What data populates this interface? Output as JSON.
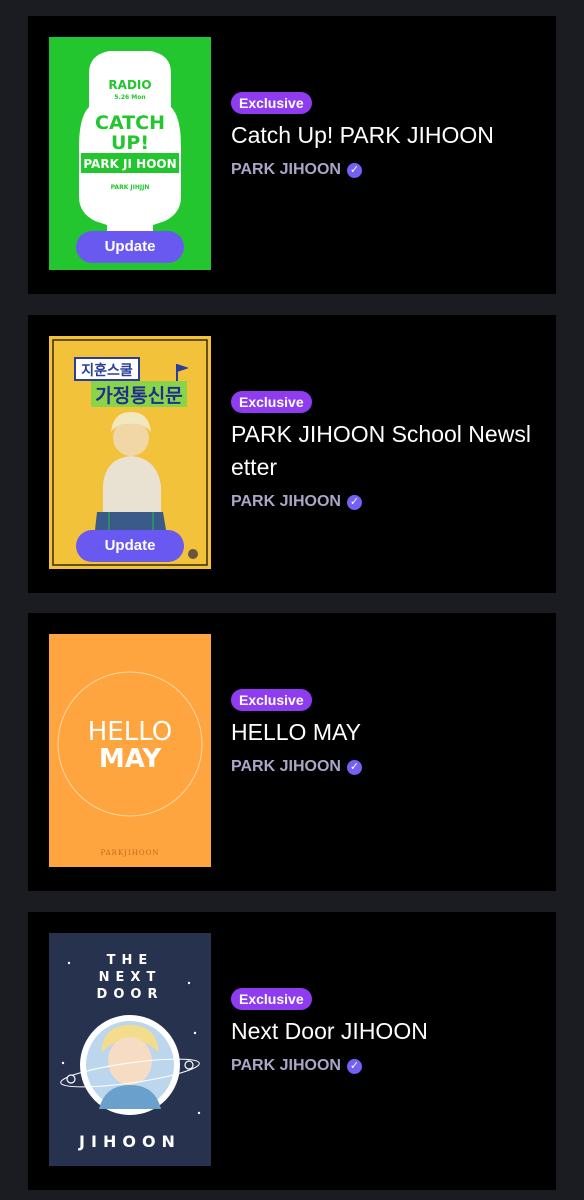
{
  "items": [
    {
      "badge": "Exclusive",
      "title": "Catch Up! PARK JIHOON",
      "artist": "PARK JIHOON",
      "update_label": "Update",
      "cover": {
        "line1": "RADIO",
        "line2": "5.26 Mon",
        "line3": "CATCH",
        "line4": "UP!",
        "line5": "PARK JI HOON",
        "line6": "PARK JIHJJN",
        "color": "#23c62f"
      }
    },
    {
      "badge": "Exclusive",
      "title": "PARK JIHOON School Newsletter",
      "artist": "PARK JIHOON",
      "update_label": "Update",
      "cover": {
        "line1": "지훈스쿨",
        "line2": "가정통신문",
        "color": "#f3c23b"
      }
    },
    {
      "badge": "Exclusive",
      "title": "HELLO MAY",
      "artist": "PARK JIHOON",
      "cover": {
        "line1": "HELLO",
        "line2": "MAY",
        "line3": "PARKJIHOON",
        "color": "#ffa540"
      }
    },
    {
      "badge": "Exclusive",
      "title": "Next Door JIHOON",
      "artist": "PARK JIHOON",
      "cover": {
        "line1": "THE",
        "line2": "NEXT",
        "line3": "DOOR",
        "line4": "JIHOON",
        "color": "#26324e"
      }
    }
  ],
  "colors": {
    "badge": "#8f3cf0",
    "update_button": "#6a59f0",
    "verified": "#7461f4",
    "artist_text": "#a9a6c6",
    "page_bg": "#1b1b22",
    "card_bg": "#000000"
  },
  "icons": {
    "verified": "verified-check-icon"
  }
}
